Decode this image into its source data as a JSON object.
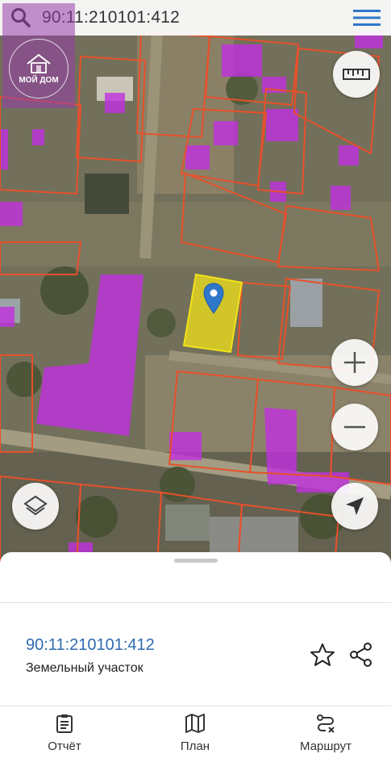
{
  "header": {
    "cadastral_number": "90:11:210101:412"
  },
  "logo": {
    "name": "МОЙ ДОМ"
  },
  "map_controls": {
    "ruler_icon": "ruler-icon",
    "zoom_in_icon": "plus-icon",
    "zoom_out_icon": "minus-icon",
    "layers_icon": "layers-icon",
    "locate_icon": "navigation-arrow-icon"
  },
  "map": {
    "parcel_outline_color": "#e8502a",
    "building_fill_color": "#c030e0",
    "selected_fill_color": "#f2e21a"
  },
  "sheet": {
    "cadastral_number": "90:11:210101:412",
    "object_type": "Земельный участок"
  },
  "tabs": [
    {
      "label": "Отчёт",
      "icon": "clipboard-icon"
    },
    {
      "label": "План",
      "icon": "map-icon"
    },
    {
      "label": "Маршрут",
      "icon": "route-icon"
    }
  ]
}
